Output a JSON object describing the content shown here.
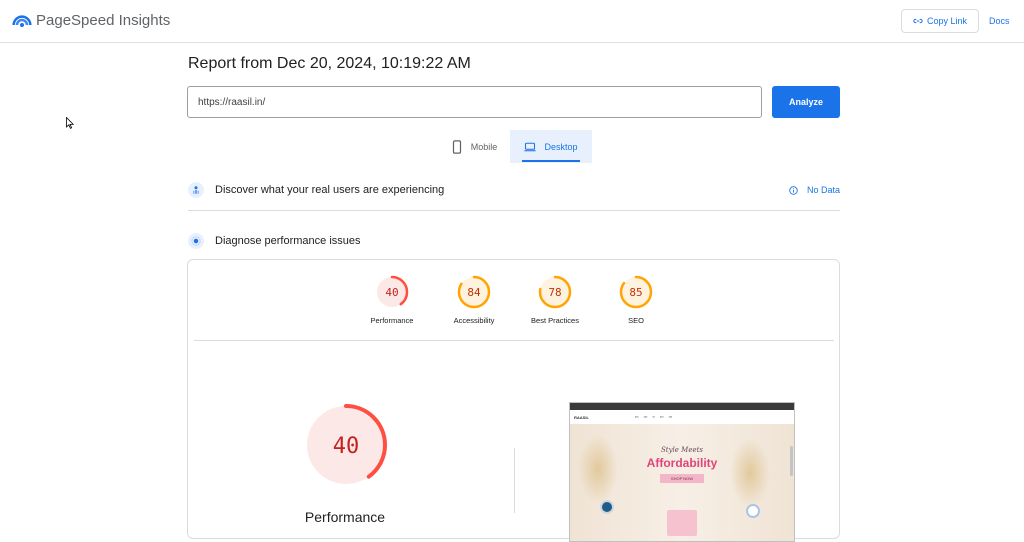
{
  "app": {
    "name": "PageSpeed Insights",
    "copy_link_label": "Copy Link",
    "docs_label": "Docs"
  },
  "report": {
    "title": "Report from Dec 20, 2024, 10:19:22 AM",
    "url_value": "https://raasil.in/",
    "analyze_label": "Analyze"
  },
  "tabs": [
    {
      "label": "Mobile",
      "icon": "smartphone-icon",
      "active": false
    },
    {
      "label": "Desktop",
      "icon": "laptop-icon",
      "active": true
    }
  ],
  "sections": {
    "real_users": {
      "text": "Discover what your real users are experiencing",
      "status": "No Data"
    },
    "diagnose": {
      "text": "Diagnose performance issues"
    }
  },
  "scores": [
    {
      "label": "Performance",
      "value": "40",
      "fraction": 0.4,
      "color": "#ff4e42",
      "bg": "#fce8e6",
      "text_color": "#c5221f"
    },
    {
      "label": "Accessibility",
      "value": "84",
      "fraction": 0.84,
      "color": "#ffa400",
      "bg": "#fff3e0",
      "text_color": "#c33300"
    },
    {
      "label": "Best Practices",
      "value": "78",
      "fraction": 0.78,
      "color": "#ffa400",
      "bg": "#fff3e0",
      "text_color": "#c33300"
    },
    {
      "label": "SEO",
      "value": "85",
      "fraction": 0.85,
      "color": "#ffa400",
      "bg": "#fff3e0",
      "text_color": "#c33300"
    }
  ],
  "main_score": {
    "label": "Performance",
    "value": "40",
    "fraction": 0.4
  },
  "screenshot": {
    "brand": "RAASIL",
    "headline_small": "Style Meets",
    "headline_big": "Affordability",
    "cta": "SHOP NOW"
  }
}
